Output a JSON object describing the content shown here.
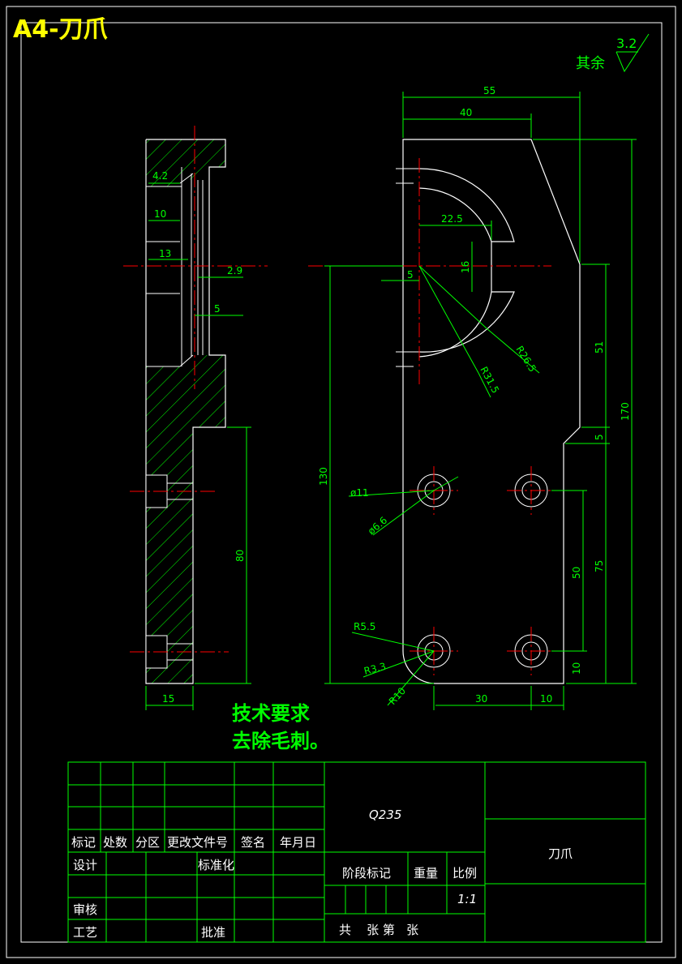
{
  "sheet": {
    "title": "A4-刀爪",
    "roughness_note": "其余",
    "roughness_value": "3.2"
  },
  "technical_requirements": {
    "heading": "技术要求",
    "item": "去除毛刺。"
  },
  "dimensions": {
    "side_view": [
      "4.2",
      "10",
      "13",
      "2.9",
      "5",
      "80",
      "15"
    ],
    "top_overall_55": "55",
    "top_40": "40",
    "d_22_5": "22.5",
    "d_16": "16",
    "d_5_left": "5",
    "r_26_5": "R26.5",
    "r_31_5": "R31.5",
    "d_51": "51",
    "d_5_right": "5",
    "d_170": "170",
    "d_130": "130",
    "dia_11": "ø11",
    "dia_6_6": "ø6.6",
    "d_75": "75",
    "d_50": "50",
    "r_5_5": "R5.5",
    "r_3_3": "R3.3",
    "r_10": "R10",
    "d_10_right": "10",
    "d_30": "30",
    "d_10_bottom": "10"
  },
  "title_block": {
    "material": "Q235",
    "part_name": "刀爪",
    "headers": {
      "mark": "标记",
      "count": "处数",
      "zone": "分区",
      "change_doc": "更改文件号",
      "signature": "签名",
      "date": "年月日"
    },
    "roles": {
      "design": "设计",
      "standardization": "标准化",
      "review": "审核",
      "process": "工艺",
      "approve": "批准"
    },
    "stage_mark": "阶段标记",
    "weight": "重量",
    "scale_label": "比例",
    "scale_value": "1:1",
    "sheets_text": "共    张 第   张"
  },
  "colors": {
    "background": "#000000",
    "outline": "#ffffff",
    "dimension": "#00ff00",
    "centerline": "#ff0000",
    "title": "#ffff00"
  }
}
